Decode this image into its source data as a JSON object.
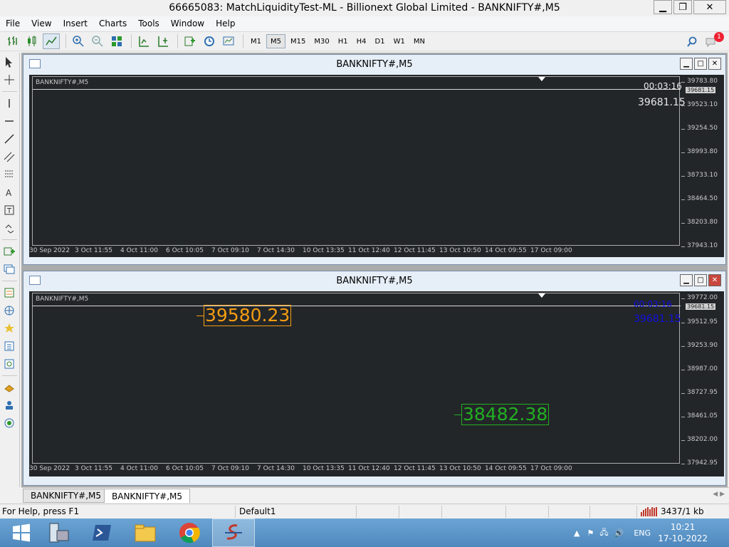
{
  "window": {
    "title": "66665083: MatchLiquidityTest-ML - Billionext Global Limited - BANKNIFTY#,M5",
    "minimize": "▁",
    "restore": "❐",
    "close": "✕"
  },
  "menu": [
    "File",
    "View",
    "Insert",
    "Charts",
    "Tools",
    "Window",
    "Help"
  ],
  "toolbar": {
    "timeframes": [
      "M1",
      "M5",
      "M15",
      "M30",
      "H1",
      "H4",
      "D1",
      "W1",
      "MN"
    ],
    "selected_timeframe": "M5",
    "notification_count": "1"
  },
  "charts": [
    {
      "window_title": "BANKNIFTY#,M5",
      "symbol_label": "BANKNIFTY#,M5",
      "y_ticks": [
        "39783.80",
        "39523.10",
        "39254.50",
        "38993.80",
        "38733.10",
        "38464.50",
        "38203.80",
        "37943.10"
      ],
      "current_price_tag": "39681.15",
      "x_ticks": [
        "30 Sep 2022",
        "3 Oct 11:55",
        "4 Oct 11:00",
        "6 Oct 10:05",
        "7 Oct 09:10",
        "7 Oct 14:30",
        "10 Oct 13:35",
        "11 Oct 12:40",
        "12 Oct 11:45",
        "13 Oct 10:50",
        "14 Oct 09:55",
        "17 Oct 09:00"
      ],
      "timer": "00:03:16",
      "price_text": "39681.15"
    },
    {
      "window_title": "BANKNIFTY#,M5",
      "symbol_label": "BANKNIFTY#,M5",
      "y_ticks": [
        "39772.00",
        "39512.95",
        "39253.90",
        "38987.00",
        "38727.95",
        "38461.05",
        "38202.00",
        "37942.95"
      ],
      "current_price_tag": "39681.15",
      "x_ticks": [
        "30 Sep 2022",
        "3 Oct 11:55",
        "4 Oct 11:00",
        "6 Oct 10:05",
        "7 Oct 09:10",
        "7 Oct 14:30",
        "10 Oct 13:35",
        "11 Oct 12:40",
        "12 Oct 11:45",
        "13 Oct 10:50",
        "14 Oct 09:55",
        "17 Oct 09:00"
      ],
      "timer": "00:03:16",
      "price_text": "39681.15",
      "level_high": "39580.23",
      "level_low": "38482.38",
      "colors": {
        "high": "#f39c12",
        "low": "#22b022",
        "timer": "#1010e0"
      }
    }
  ],
  "tabs": [
    "BANKNIFTY#,M5",
    "BANKNIFTY#,M5"
  ],
  "active_tab": 1,
  "status": {
    "help": "For Help, press F1",
    "profile": "Default1",
    "traffic": "3437/1 kb"
  },
  "taskbar": {
    "language": "ENG",
    "time": "10:21",
    "date": "17-10-2022"
  }
}
